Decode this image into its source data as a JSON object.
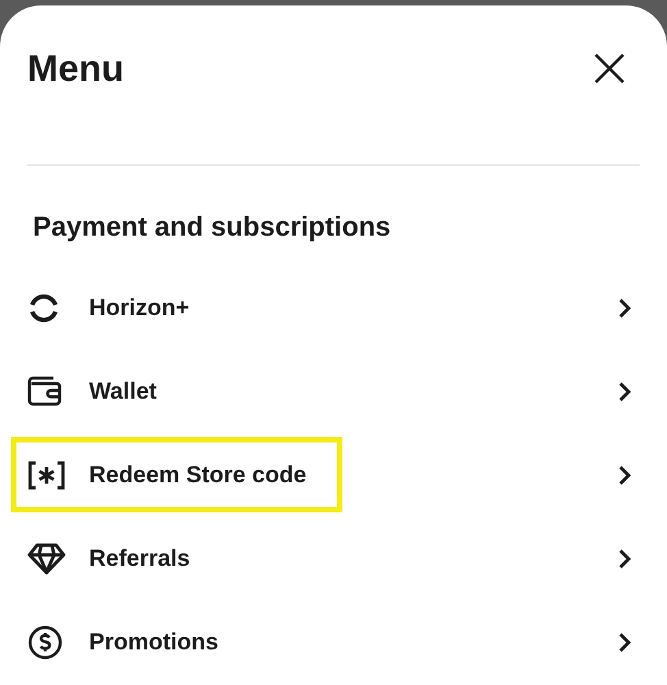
{
  "title": "Menu",
  "section": {
    "heading": "Payment and subscriptions",
    "items": [
      {
        "kind": "horizon",
        "label": "Horizon+",
        "highlighted": false
      },
      {
        "kind": "wallet",
        "label": "Wallet",
        "highlighted": false
      },
      {
        "kind": "code",
        "label": "Redeem Store code",
        "highlighted": true
      },
      {
        "kind": "diamond",
        "label": "Referrals",
        "highlighted": false
      },
      {
        "kind": "dollar",
        "label": "Promotions",
        "highlighted": false
      }
    ]
  }
}
